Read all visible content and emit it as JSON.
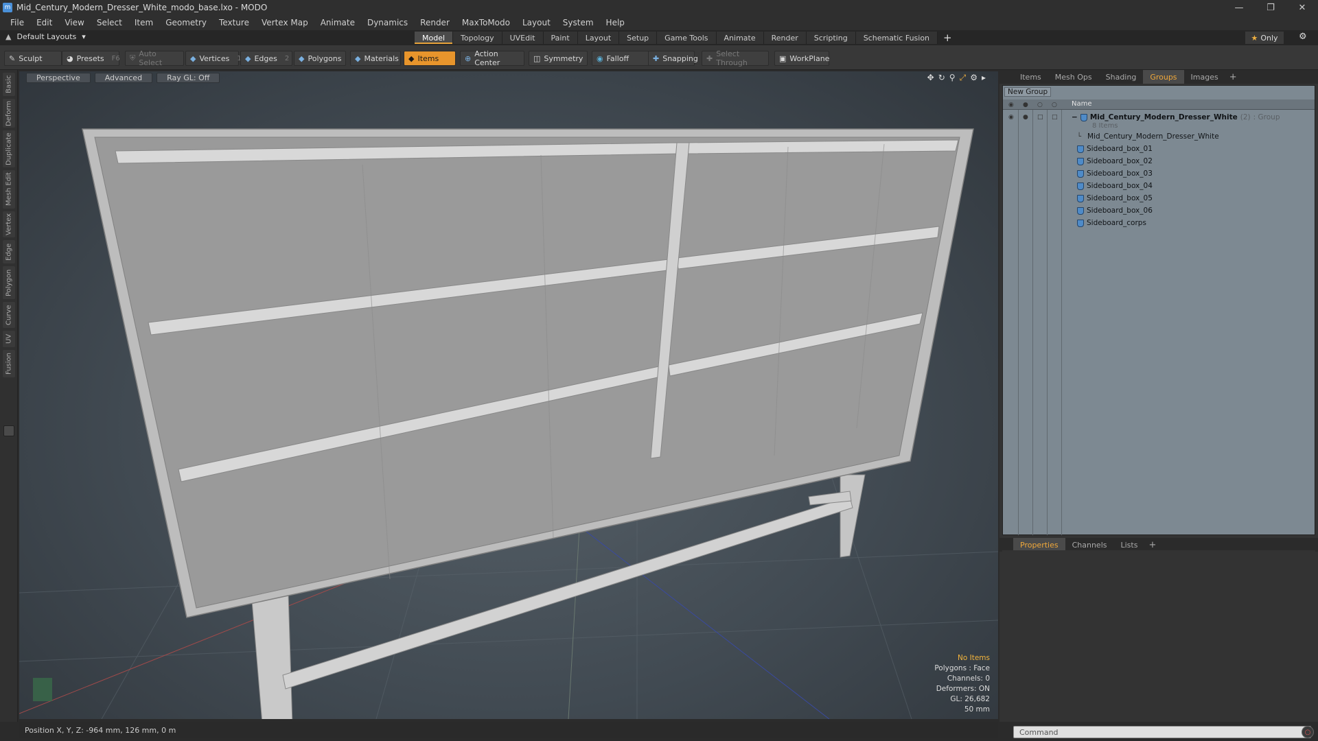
{
  "window": {
    "title": "Mid_Century_Modern_Dresser_White_modo_base.lxo - MODO",
    "app_icon": "modo-app-icon"
  },
  "menu": [
    "File",
    "Edit",
    "View",
    "Select",
    "Item",
    "Geometry",
    "Texture",
    "Vertex Map",
    "Animate",
    "Dynamics",
    "Render",
    "MaxToModo",
    "Layout",
    "System",
    "Help"
  ],
  "layouts": {
    "label": "Default Layouts"
  },
  "tabs": [
    "Model",
    "Topology",
    "UVEdit",
    "Paint",
    "Layout",
    "Setup",
    "Game Tools",
    "Animate",
    "Render",
    "Scripting",
    "Schematic Fusion"
  ],
  "active_tab": "Model",
  "only_label": "Only",
  "toolbar": {
    "sculpt": "Sculpt",
    "presets": "Presets",
    "presets_key": "F6",
    "auto_select": "Auto Select",
    "vertices": "Vertices",
    "vertices_count": "1",
    "edges": "Edges",
    "edges_count": "2",
    "polygons": "Polygons",
    "materials": "Materials",
    "items": "Items",
    "action_center": "Action Center",
    "symmetry": "Symmetry",
    "falloff": "Falloff",
    "snapping": "Snapping",
    "select_through": "Select Through",
    "workplane": "WorkPlane"
  },
  "left_tabs": [
    "Basic",
    "Deform",
    "Duplicate",
    "Mesh Edit",
    "Vertex",
    "Edge",
    "Polygon",
    "Curve",
    "UV",
    "Fusion"
  ],
  "viewport": {
    "view": "Perspective",
    "shading": "Advanced",
    "raygl": "Ray GL: Off",
    "info": {
      "no_items": "No Items",
      "polygons": "Polygons : Face",
      "channels": "Channels: 0",
      "deformers": "Deformers: ON",
      "gl": "GL: 26,682",
      "scale": "50 mm"
    }
  },
  "status": {
    "position": "Position X, Y, Z:  -964 mm, 126 mm, 0 m"
  },
  "panel_tabs": [
    "Items",
    "Mesh Ops",
    "Shading",
    "Groups",
    "Images"
  ],
  "panel_active_tab": "Groups",
  "groups": {
    "new_group": "New Group",
    "name_header": "Name",
    "root": {
      "name": "Mid_Century_Modern_Dresser_White",
      "count": "(2)",
      "type": ": Group",
      "subtitle": "8 Items"
    },
    "children": [
      {
        "name": "Mid_Century_Modern_Dresser_White",
        "icon": "locator-icon"
      },
      {
        "name": "Sideboard_box_01",
        "icon": "mesh-icon"
      },
      {
        "name": "Sideboard_box_02",
        "icon": "mesh-icon"
      },
      {
        "name": "Sideboard_box_03",
        "icon": "mesh-icon"
      },
      {
        "name": "Sideboard_box_04",
        "icon": "mesh-icon"
      },
      {
        "name": "Sideboard_box_05",
        "icon": "mesh-icon"
      },
      {
        "name": "Sideboard_box_06",
        "icon": "mesh-icon"
      },
      {
        "name": "Sideboard_corps",
        "icon": "mesh-icon"
      }
    ]
  },
  "props_tabs": [
    "Properties",
    "Channels",
    "Lists"
  ],
  "props_active_tab": "Properties",
  "command": {
    "placeholder": "Command"
  },
  "colors": {
    "accent": "#e8952c",
    "tab_active_text": "#f0a83a",
    "no_items": "#f3b43c"
  }
}
